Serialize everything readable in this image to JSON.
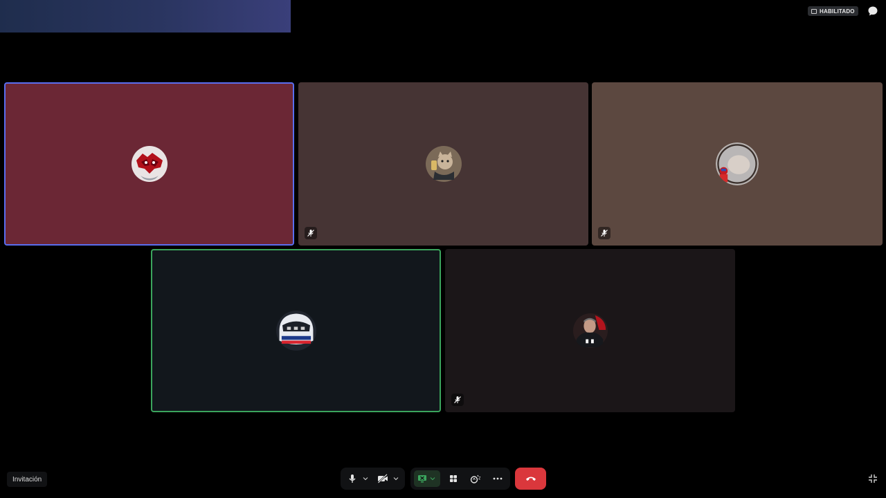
{
  "header": {
    "status_badge": "HABILITADO"
  },
  "participants": [
    {
      "id": "p1",
      "bg": "#6b2735",
      "state": "speaking",
      "muted": false
    },
    {
      "id": "p2",
      "bg": "#463434",
      "state": "idle",
      "muted": true
    },
    {
      "id": "p3",
      "bg": "#5c4840",
      "state": "idle",
      "muted": true
    },
    {
      "id": "p4",
      "bg": "#12171c",
      "state": "active",
      "muted": false
    },
    {
      "id": "p5",
      "bg": "#1b1618",
      "state": "idle",
      "muted": true
    }
  ],
  "footer": {
    "invite_label": "Invitación"
  },
  "colors": {
    "speaking_border": "#5a6ef0",
    "active_border": "#3ba55d",
    "leave_button": "#da373c",
    "screen_share_active": "#3ba55d"
  }
}
